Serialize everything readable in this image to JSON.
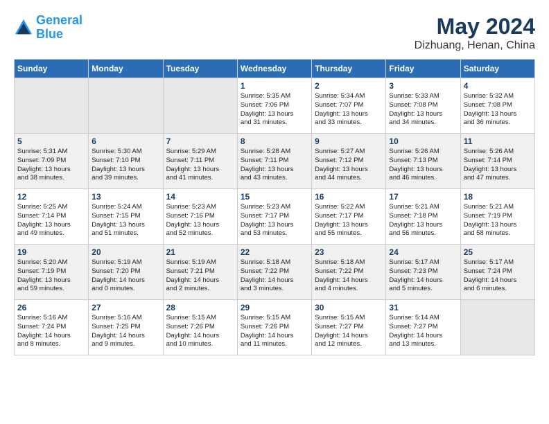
{
  "logo": {
    "line1": "General",
    "line2": "Blue"
  },
  "title": "May 2024",
  "location": "Dizhuang, Henan, China",
  "headers": [
    "Sunday",
    "Monday",
    "Tuesday",
    "Wednesday",
    "Thursday",
    "Friday",
    "Saturday"
  ],
  "weeks": [
    [
      {
        "day": "",
        "content": "",
        "empty": true
      },
      {
        "day": "",
        "content": "",
        "empty": true
      },
      {
        "day": "",
        "content": "",
        "empty": true
      },
      {
        "day": "1",
        "content": "Sunrise: 5:35 AM\nSunset: 7:06 PM\nDaylight: 13 hours\nand 31 minutes."
      },
      {
        "day": "2",
        "content": "Sunrise: 5:34 AM\nSunset: 7:07 PM\nDaylight: 13 hours\nand 33 minutes."
      },
      {
        "day": "3",
        "content": "Sunrise: 5:33 AM\nSunset: 7:08 PM\nDaylight: 13 hours\nand 34 minutes."
      },
      {
        "day": "4",
        "content": "Sunrise: 5:32 AM\nSunset: 7:08 PM\nDaylight: 13 hours\nand 36 minutes."
      }
    ],
    [
      {
        "day": "5",
        "content": "Sunrise: 5:31 AM\nSunset: 7:09 PM\nDaylight: 13 hours\nand 38 minutes."
      },
      {
        "day": "6",
        "content": "Sunrise: 5:30 AM\nSunset: 7:10 PM\nDaylight: 13 hours\nand 39 minutes."
      },
      {
        "day": "7",
        "content": "Sunrise: 5:29 AM\nSunset: 7:11 PM\nDaylight: 13 hours\nand 41 minutes."
      },
      {
        "day": "8",
        "content": "Sunrise: 5:28 AM\nSunset: 7:11 PM\nDaylight: 13 hours\nand 43 minutes."
      },
      {
        "day": "9",
        "content": "Sunrise: 5:27 AM\nSunset: 7:12 PM\nDaylight: 13 hours\nand 44 minutes."
      },
      {
        "day": "10",
        "content": "Sunrise: 5:26 AM\nSunset: 7:13 PM\nDaylight: 13 hours\nand 46 minutes."
      },
      {
        "day": "11",
        "content": "Sunrise: 5:26 AM\nSunset: 7:14 PM\nDaylight: 13 hours\nand 47 minutes."
      }
    ],
    [
      {
        "day": "12",
        "content": "Sunrise: 5:25 AM\nSunset: 7:14 PM\nDaylight: 13 hours\nand 49 minutes."
      },
      {
        "day": "13",
        "content": "Sunrise: 5:24 AM\nSunset: 7:15 PM\nDaylight: 13 hours\nand 51 minutes."
      },
      {
        "day": "14",
        "content": "Sunrise: 5:23 AM\nSunset: 7:16 PM\nDaylight: 13 hours\nand 52 minutes."
      },
      {
        "day": "15",
        "content": "Sunrise: 5:23 AM\nSunset: 7:17 PM\nDaylight: 13 hours\nand 53 minutes."
      },
      {
        "day": "16",
        "content": "Sunrise: 5:22 AM\nSunset: 7:17 PM\nDaylight: 13 hours\nand 55 minutes."
      },
      {
        "day": "17",
        "content": "Sunrise: 5:21 AM\nSunset: 7:18 PM\nDaylight: 13 hours\nand 56 minutes."
      },
      {
        "day": "18",
        "content": "Sunrise: 5:21 AM\nSunset: 7:19 PM\nDaylight: 13 hours\nand 58 minutes."
      }
    ],
    [
      {
        "day": "19",
        "content": "Sunrise: 5:20 AM\nSunset: 7:19 PM\nDaylight: 13 hours\nand 59 minutes."
      },
      {
        "day": "20",
        "content": "Sunrise: 5:19 AM\nSunset: 7:20 PM\nDaylight: 14 hours\nand 0 minutes."
      },
      {
        "day": "21",
        "content": "Sunrise: 5:19 AM\nSunset: 7:21 PM\nDaylight: 14 hours\nand 2 minutes."
      },
      {
        "day": "22",
        "content": "Sunrise: 5:18 AM\nSunset: 7:22 PM\nDaylight: 14 hours\nand 3 minutes."
      },
      {
        "day": "23",
        "content": "Sunrise: 5:18 AM\nSunset: 7:22 PM\nDaylight: 14 hours\nand 4 minutes."
      },
      {
        "day": "24",
        "content": "Sunrise: 5:17 AM\nSunset: 7:23 PM\nDaylight: 14 hours\nand 5 minutes."
      },
      {
        "day": "25",
        "content": "Sunrise: 5:17 AM\nSunset: 7:24 PM\nDaylight: 14 hours\nand 6 minutes."
      }
    ],
    [
      {
        "day": "26",
        "content": "Sunrise: 5:16 AM\nSunset: 7:24 PM\nDaylight: 14 hours\nand 8 minutes."
      },
      {
        "day": "27",
        "content": "Sunrise: 5:16 AM\nSunset: 7:25 PM\nDaylight: 14 hours\nand 9 minutes."
      },
      {
        "day": "28",
        "content": "Sunrise: 5:15 AM\nSunset: 7:26 PM\nDaylight: 14 hours\nand 10 minutes."
      },
      {
        "day": "29",
        "content": "Sunrise: 5:15 AM\nSunset: 7:26 PM\nDaylight: 14 hours\nand 11 minutes."
      },
      {
        "day": "30",
        "content": "Sunrise: 5:15 AM\nSunset: 7:27 PM\nDaylight: 14 hours\nand 12 minutes."
      },
      {
        "day": "31",
        "content": "Sunrise: 5:14 AM\nSunset: 7:27 PM\nDaylight: 14 hours\nand 13 minutes."
      },
      {
        "day": "",
        "content": "",
        "empty": true
      }
    ]
  ]
}
